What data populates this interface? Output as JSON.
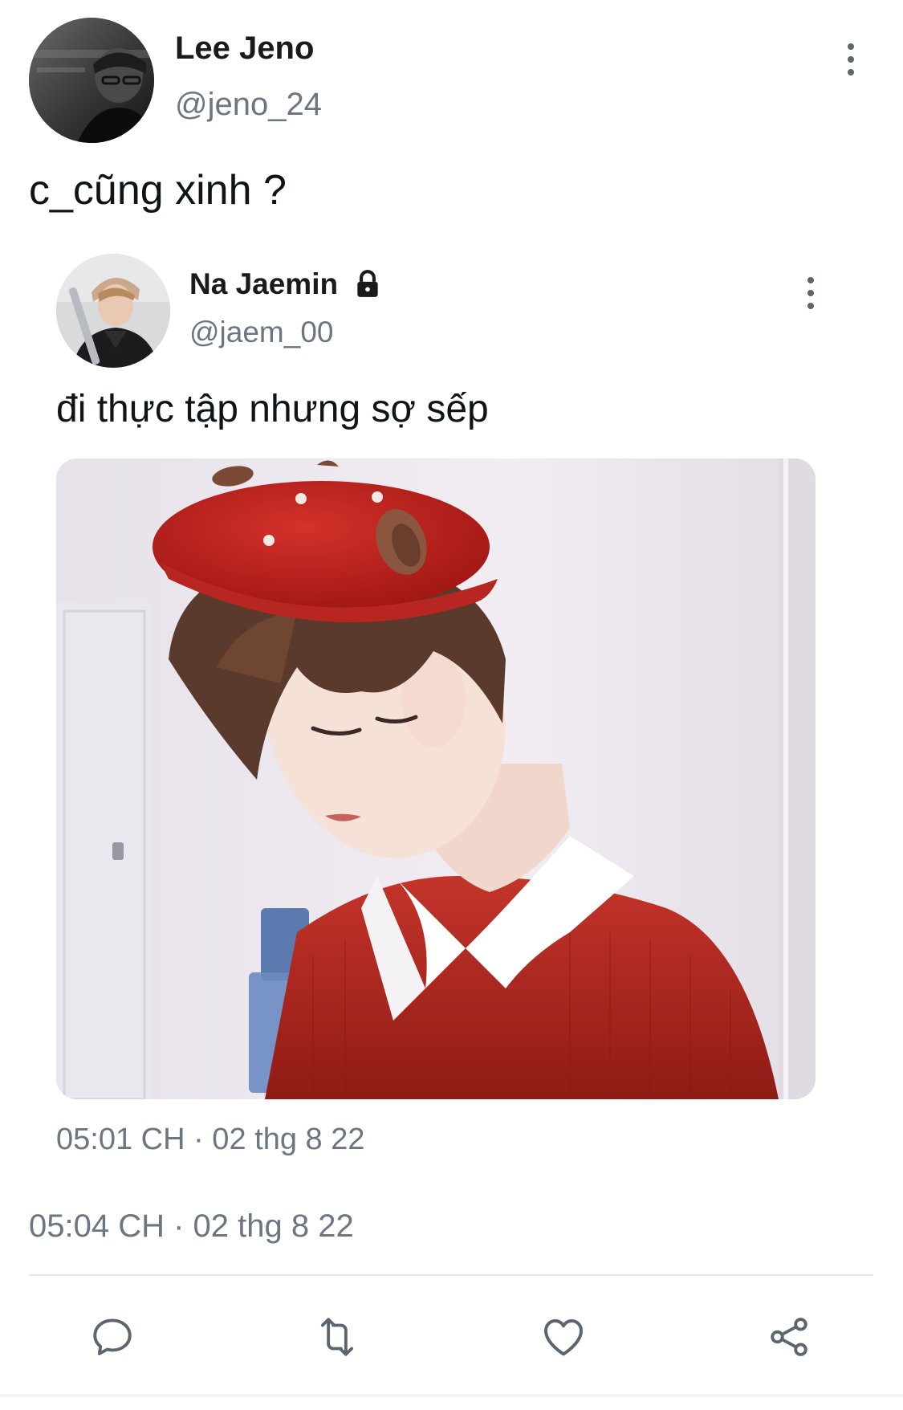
{
  "tweet": {
    "author": {
      "name": "Lee Jeno",
      "handle": "@jeno_24",
      "avatar_icon": "avatar-photo"
    },
    "text": "c_cũng xinh ?",
    "timestamp": "05:04 CH · 02 thg 8 22",
    "more_icon": "more-vertical-icon"
  },
  "quoted_tweet": {
    "author": {
      "name": "Na Jaemin",
      "handle": "@jaem_00",
      "protected_icon": "lock-icon",
      "avatar_icon": "avatar-photo"
    },
    "text": "đi thực tập nhưng sợ sếp",
    "timestamp": "05:01 CH · 02 thg 8 22",
    "media_icon": "photo-person-red-beret",
    "more_icon": "more-vertical-icon"
  },
  "actions": [
    {
      "icon": "reply-icon"
    },
    {
      "icon": "retweet-icon"
    },
    {
      "icon": "like-icon"
    },
    {
      "icon": "share-icon"
    }
  ],
  "colors": {
    "text_primary": "#0f1419",
    "text_secondary": "#6b7680",
    "icon": "#5b6570",
    "divider": "#e6e9ec"
  }
}
